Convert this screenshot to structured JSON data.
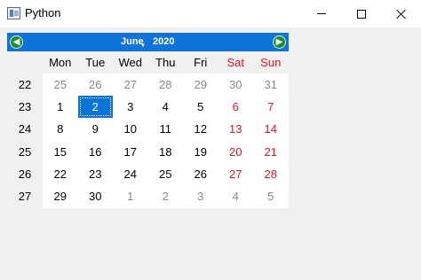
{
  "window": {
    "title": "Python",
    "icons": {
      "app": "python-app-icon",
      "minimize": "minimize-icon",
      "maximize": "maximize-icon",
      "close": "close-icon"
    }
  },
  "calendar": {
    "month": "June",
    "year": "2020",
    "nav_prev_icon": "arrow-left-icon",
    "nav_next_icon": "arrow-right-icon",
    "day_headers": [
      "Mon",
      "Tue",
      "Wed",
      "Thu",
      "Fri",
      "Sat",
      "Sun"
    ],
    "weeks": [
      {
        "week": "22",
        "days": [
          "25",
          "26",
          "27",
          "28",
          "29",
          "30",
          "31"
        ]
      },
      {
        "week": "23",
        "days": [
          "1",
          "2",
          "3",
          "4",
          "5",
          "6",
          "7"
        ]
      },
      {
        "week": "24",
        "days": [
          "8",
          "9",
          "10",
          "11",
          "12",
          "13",
          "14"
        ]
      },
      {
        "week": "25",
        "days": [
          "15",
          "16",
          "17",
          "18",
          "19",
          "20",
          "21"
        ]
      },
      {
        "week": "26",
        "days": [
          "22",
          "23",
          "24",
          "25",
          "26",
          "27",
          "28"
        ]
      },
      {
        "week": "27",
        "days": [
          "29",
          "30",
          "1",
          "2",
          "3",
          "4",
          "5"
        ]
      }
    ],
    "selected_date": "2020-06-02",
    "colors": {
      "nav_bg": "#0f73d9",
      "weekend": "#e81123",
      "other_month": "#888888",
      "selected_bg": "#0a74da",
      "arrow": "#1e8f2e"
    }
  }
}
